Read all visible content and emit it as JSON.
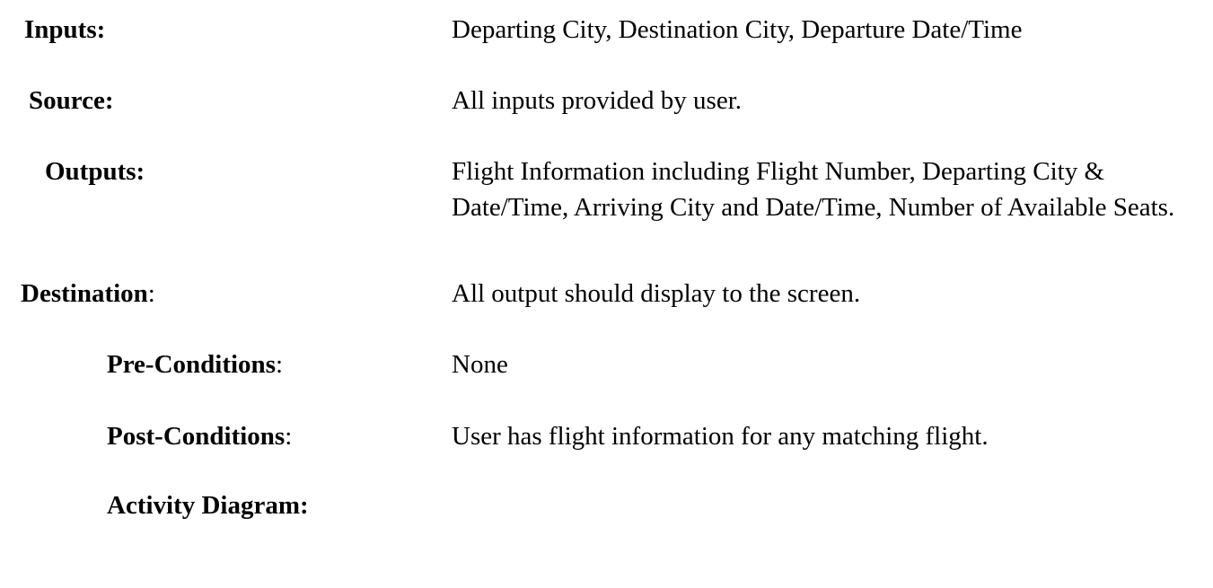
{
  "rows": [
    {
      "label": "Inputs:",
      "suffix": "",
      "value": "Departing City, Destination City, Departure Date/Time"
    },
    {
      "label": "Source:",
      "suffix": "",
      "value": "All inputs provided by user."
    },
    {
      "label": "Outputs:",
      "suffix": "",
      "value": "Flight Information including Flight Number, Departing City & Date/Time, Arriving City and Date/Time, Number of Available Seats."
    },
    {
      "label": "Destination",
      "suffix": ":",
      "value": "All output should display to the screen."
    },
    {
      "label": "Pre-Conditions",
      "suffix": ":",
      "value": "None"
    },
    {
      "label": "Post-Conditions",
      "suffix": ":",
      "value": "User has flight information for any matching flight."
    },
    {
      "label": "Activity Diagram:",
      "suffix": "",
      "value": ""
    }
  ]
}
